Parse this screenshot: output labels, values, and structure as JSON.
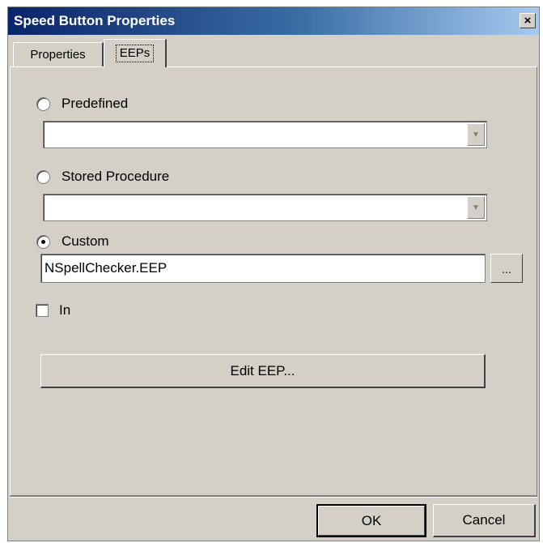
{
  "window": {
    "title": "Speed Button Properties",
    "close_glyph": "×"
  },
  "tabs": [
    {
      "label": "Properties"
    },
    {
      "label": "EEPs"
    }
  ],
  "options": {
    "predefined": {
      "label": "Predefined",
      "selected": false,
      "value": ""
    },
    "stored_procedure": {
      "label": "Stored Procedure",
      "selected": false,
      "value": ""
    },
    "custom": {
      "label": "Custom",
      "selected": true,
      "value": "NSpellChecker.EEP",
      "browse_label": "..."
    }
  },
  "in_checkbox": {
    "label": "In",
    "checked": false
  },
  "edit_eep_button": {
    "label": "Edit EEP..."
  },
  "footer": {
    "ok_label": "OK",
    "cancel_label": "Cancel"
  },
  "icons": {
    "dropdown": "dropdown-arrow-icon",
    "close": "close-icon"
  }
}
